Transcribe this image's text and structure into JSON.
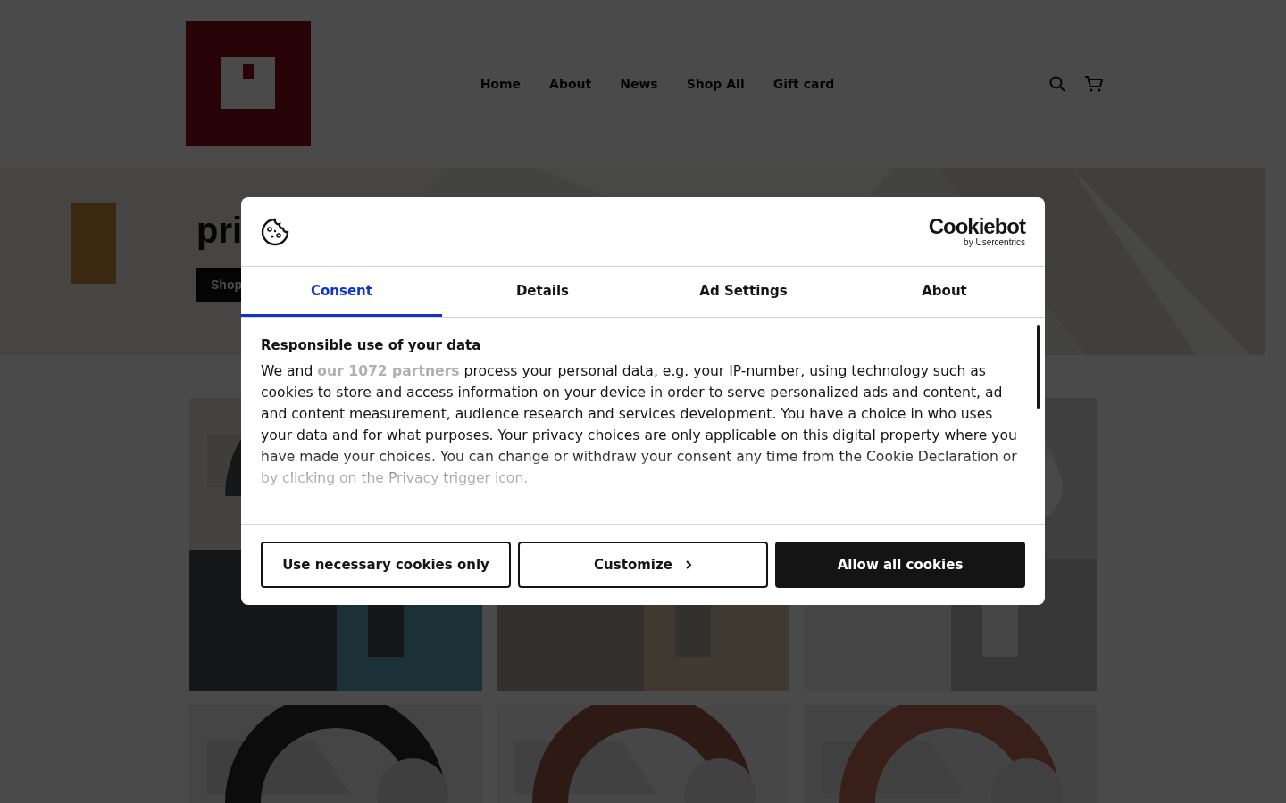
{
  "header": {
    "nav": [
      {
        "label": "Home"
      },
      {
        "label": "About"
      },
      {
        "label": "News"
      },
      {
        "label": "Shop All"
      },
      {
        "label": "Gift card"
      }
    ]
  },
  "hero": {
    "title": "pri",
    "button": "Shop"
  },
  "cookie_dialog": {
    "brand": "Cookiebot",
    "brand_sub": "by Usercentrics",
    "tabs": [
      {
        "label": "Consent",
        "selected": true
      },
      {
        "label": "Details",
        "selected": false
      },
      {
        "label": "Ad Settings",
        "selected": false
      },
      {
        "label": "About",
        "selected": false
      }
    ],
    "heading": "Responsible use of your data",
    "text_before": "We and ",
    "link": "our 1072 partners",
    "text_after": " process your personal data, e.g. your IP-number, using technology such as cookies to store and access information on your device in order to serve personalized ads and content, ad and content measurement, audience research and services development. You have a choice in who uses your data and for what purposes. Your privacy choices are only applicable on this digital property where you have made your choices. You can change or withdraw your consent any time from the Cookie Declaration or by clicking on the Privacy trigger icon.",
    "buttons": [
      {
        "kind": "outline",
        "label": "Use necessary cookies only"
      },
      {
        "kind": "chevron",
        "label": "Customize"
      },
      {
        "kind": "primary",
        "label": "Allow all cookies"
      }
    ]
  }
}
